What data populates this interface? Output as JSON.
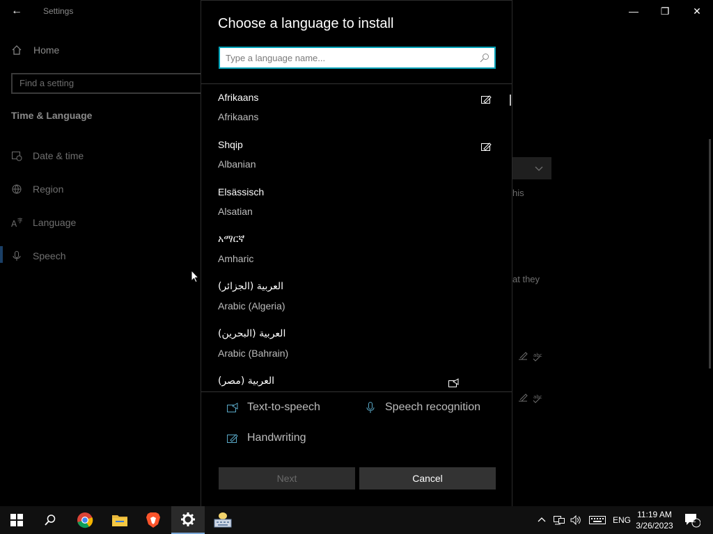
{
  "window": {
    "title": "Settings",
    "back_glyph": "←",
    "min_glyph": "—",
    "max_glyph": "❐",
    "close_glyph": "✕"
  },
  "nav": {
    "home": "Home",
    "search_placeholder": "Find a setting",
    "section": "Time & Language",
    "items": [
      {
        "label": "Date & time",
        "icon": "date-time-icon"
      },
      {
        "label": "Region",
        "icon": "globe-icon"
      },
      {
        "label": "Language",
        "icon": "language-icon"
      },
      {
        "label": "Speech",
        "icon": "microphone-icon"
      }
    ]
  },
  "background_fragments": {
    "text1": "his",
    "text2": "at they"
  },
  "dialog": {
    "title": "Choose a language to install",
    "search_placeholder": "Type a language name...",
    "languages": [
      {
        "native": "Afrikaans",
        "english": "Afrikaans",
        "icon": "handwriting-icon"
      },
      {
        "native": "Shqip",
        "english": "Albanian",
        "icon": "handwriting-icon"
      },
      {
        "native": "Elsässisch",
        "english": "Alsatian",
        "icon": ""
      },
      {
        "native": "አማርኛ",
        "english": "Amharic",
        "icon": ""
      },
      {
        "native": "العربية (الجزائر)",
        "english": "Arabic (Algeria)",
        "icon": ""
      },
      {
        "native": "العربية (البحرين)",
        "english": "Arabic (Bahrain)",
        "icon": ""
      },
      {
        "native": "العربية (مصر)",
        "english": "",
        "icon": "text-to-speech-icon"
      }
    ],
    "features": {
      "tts": "Text-to-speech",
      "speech": "Speech recognition",
      "handwriting": "Handwriting"
    },
    "next_label": "Next",
    "cancel_label": "Cancel"
  },
  "taskbar": {
    "apps": [
      "start-icon",
      "search-icon",
      "chrome-icon",
      "file-explorer-icon",
      "brave-icon",
      "settings-icon",
      "keyboard-app-icon"
    ],
    "input_lang": "ENG",
    "time": "11:19 AM",
    "date": "3/26/2023",
    "notification_count": "2"
  },
  "colors": {
    "accent": "#00a2b8",
    "background": "#000000",
    "taskbar": "#101010"
  }
}
